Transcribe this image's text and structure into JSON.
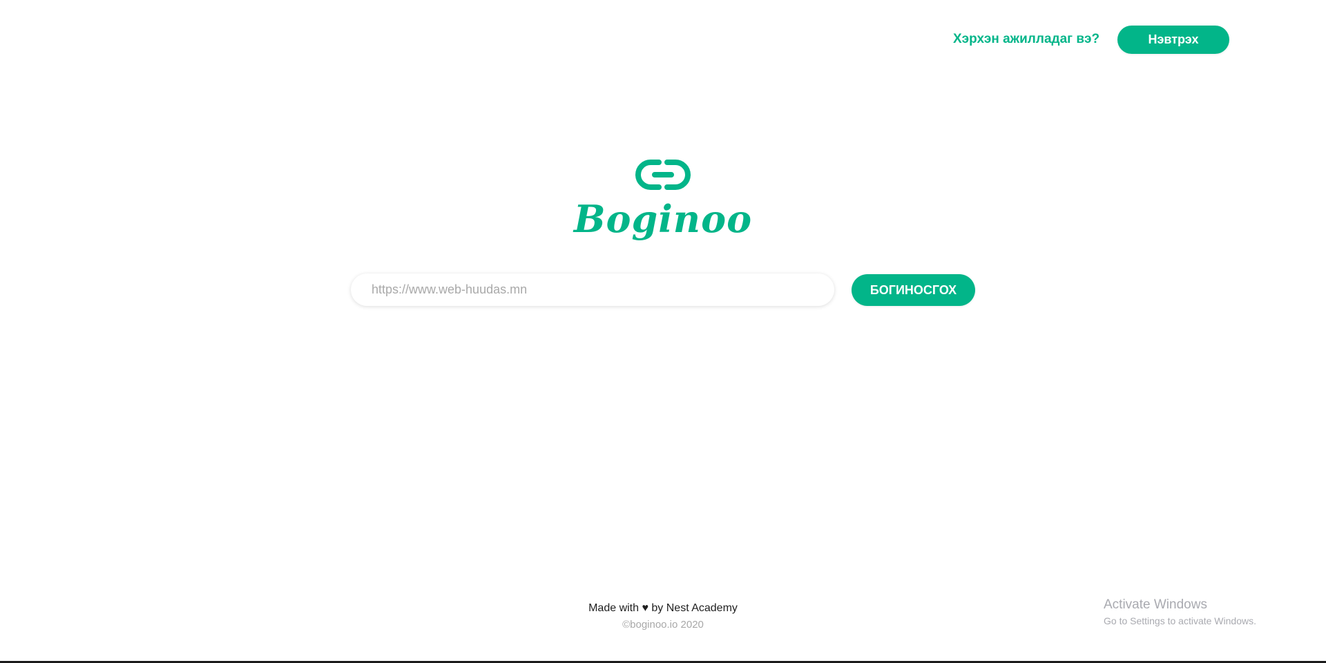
{
  "header": {
    "help_link": "Хэрхэн ажилладаг вэ?",
    "login_button": "Нэвтрэх"
  },
  "brand": {
    "logo_icon": "link-icon",
    "name": "Boginoo",
    "accent_color": "#02b589"
  },
  "shortener": {
    "url_placeholder": "https://www.web-huudas.mn",
    "url_value": "",
    "shorten_button": "БОГИНОСГОХ"
  },
  "footer": {
    "made_with": "Made with ♥ by Nest Academy",
    "copyright": "©boginoo.io 2020"
  },
  "system_overlay": {
    "title": "Activate Windows",
    "subtitle": "Go to Settings to activate Windows."
  }
}
